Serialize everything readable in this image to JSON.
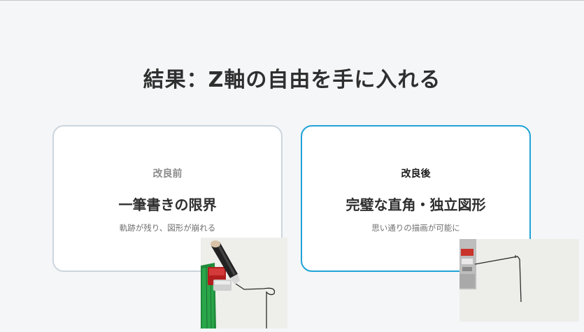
{
  "slide": {
    "title": "結果：Z軸の自由を手に入れる"
  },
  "cards": {
    "before": {
      "label": "改良前",
      "heading": "一筆書きの限界",
      "description": "軌跡が残り、図形が崩れる"
    },
    "after": {
      "label": "改良後",
      "heading": "完璧な直角・独立図形",
      "description": "思い通りの描画が可能に"
    }
  },
  "colors": {
    "background": "#f5f6f8",
    "before_border": "#ccd5de",
    "after_border": "#1fa3d6"
  }
}
